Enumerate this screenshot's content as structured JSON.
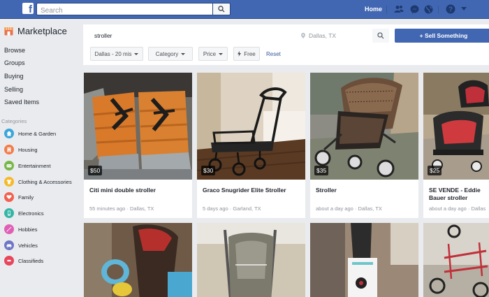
{
  "topbar": {
    "logo_letter": "f",
    "search_placeholder": "Search",
    "home_label": "Home",
    "icons": [
      "friends-icon",
      "messenger-icon",
      "globe-icon",
      "help-icon",
      "dropdown-icon"
    ]
  },
  "sidebar": {
    "title": "Marketplace",
    "links": [
      "Browse",
      "Groups",
      "Buying",
      "Selling",
      "Saved Items"
    ],
    "categories_header": "Categories",
    "categories": [
      {
        "label": "Home & Garden",
        "icon": "home-icon",
        "color": "#3aa6d9"
      },
      {
        "label": "Housing",
        "icon": "housing-icon",
        "color": "#f47b49"
      },
      {
        "label": "Entertainment",
        "icon": "entertainment-icon",
        "color": "#78b84a"
      },
      {
        "label": "Clothing & Accessories",
        "icon": "clothing-icon",
        "color": "#f7b928"
      },
      {
        "label": "Family",
        "icon": "family-icon",
        "color": "#f2604e"
      },
      {
        "label": "Electronics",
        "icon": "electronics-icon",
        "color": "#35b5a6"
      },
      {
        "label": "Hobbies",
        "icon": "hobbies-icon",
        "color": "#e05fb5"
      },
      {
        "label": "Vehicles",
        "icon": "vehicles-icon",
        "color": "#6f76c6"
      },
      {
        "label": "Classifieds",
        "icon": "classifieds-icon",
        "color": "#e8465b"
      }
    ]
  },
  "search": {
    "query": "stroller",
    "location_placeholder": "Dallas, TX",
    "sell_label": "+ Sell Something"
  },
  "filters": {
    "location": "Dallas - 20 mis",
    "category": "Category",
    "price": "Price",
    "free": "Free",
    "reset": "Reset"
  },
  "listings": [
    {
      "price": "$50",
      "title": "Citi mini double stroller",
      "meta": "55 minutes ago · Dallas, TX"
    },
    {
      "price": "$30",
      "title": "Graco Snugrider Elite Stroller",
      "meta": "5 days ago · Garland, TX"
    },
    {
      "price": "$35",
      "title": "Stroller",
      "meta": "about a day ago · Dallas, TX"
    },
    {
      "price": "$25",
      "title": "SE VENDE - Eddie Bauer stroller",
      "meta": "about a day ago · Dallas"
    }
  ],
  "colors": {
    "brand_blue": "#4267b2",
    "link_blue": "#365899",
    "bg_gray": "#e9ebee"
  }
}
